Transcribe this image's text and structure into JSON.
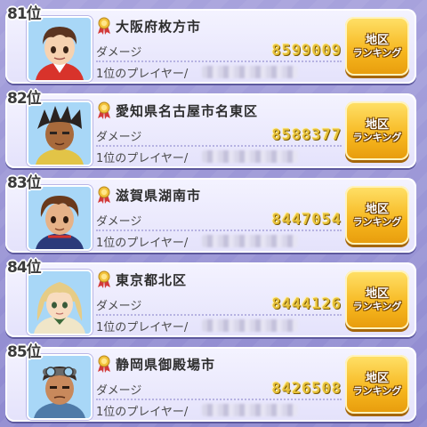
{
  "colors": {
    "row_bg": "#eceafc",
    "damage_gold": "#e7c13a",
    "button_orange": "#f6b61e"
  },
  "labels": {
    "damage": "ダメージ",
    "top_player": "1位のプレイヤー/",
    "button_line1": "地区",
    "button_line2": "ランキング"
  },
  "rows": [
    {
      "rank": "81位",
      "region": "大阪府枚方市",
      "damage": "8599009",
      "avatar": "boy-red-jacket-avatar"
    },
    {
      "rank": "82位",
      "region": "愛知県名古屋市名東区",
      "damage": "8588377",
      "avatar": "spiky-hair-boy-avatar"
    },
    {
      "rank": "83位",
      "region": "滋賀県湖南市",
      "damage": "8447054",
      "avatar": "brown-hair-boy-avatar"
    },
    {
      "rank": "84位",
      "region": "東京都北区",
      "damage": "8444126",
      "avatar": "blonde-girl-avatar"
    },
    {
      "rank": "85位",
      "region": "静岡県御殿場市",
      "damage": "8426508",
      "avatar": "goggles-man-avatar"
    }
  ]
}
